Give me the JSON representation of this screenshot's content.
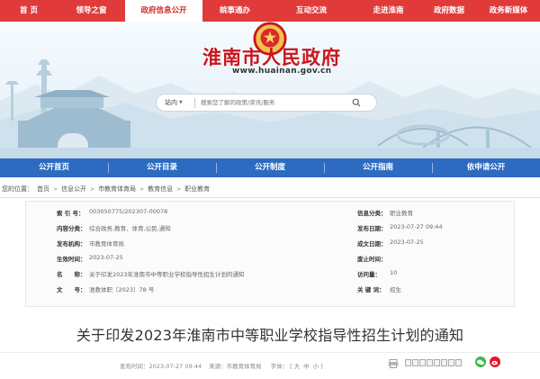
{
  "topnav": {
    "items": [
      "首 页",
      "领导之窗",
      "政府信息公开",
      "皖事通办",
      "互动交流",
      "走进淮南",
      "政府数据",
      "政务新媒体"
    ],
    "active_index": 2
  },
  "header": {
    "title": "淮南市人民政府",
    "url": "www.huainan.gov.cn"
  },
  "search": {
    "scope": "站内",
    "placeholder": "搜索您了解的政策/资讯/服务"
  },
  "subnav": {
    "items": [
      "公开首页",
      "公开目录",
      "公开制度",
      "公开指南",
      "依申请公开"
    ]
  },
  "breadcrumb": {
    "label": "您的位置：",
    "items": [
      "首页",
      "信息公开",
      "市教育体育局",
      "教育信息",
      "职业教育"
    ]
  },
  "info": {
    "left": [
      {
        "k": "索 引 号：",
        "v": "003050775/202307-00078"
      },
      {
        "k": "内容分类：",
        "v": "综合政务,教育、体育,公民,通知"
      },
      {
        "k": "发布机构：",
        "v": "市教育体育局"
      },
      {
        "k": "生效时间：",
        "v": "2023-07-25"
      },
      {
        "k": "名　　称：",
        "v": "关于印发2023年淮南市中等职业学校指导性招生计划的通知"
      },
      {
        "k": "文　　号：",
        "v": "淮教体职〔2023〕78 号"
      }
    ],
    "right": [
      {
        "k": "信息分类：",
        "v": "职业教育"
      },
      {
        "k": "发布日期：",
        "v": "2023-07-27 09:44"
      },
      {
        "k": "成文日期：",
        "v": "2023-07-25"
      },
      {
        "k": "废止时间：",
        "v": ""
      },
      {
        "k": "访问量：",
        "v": "10"
      },
      {
        "k": "关 键 词：",
        "v": "招生"
      }
    ]
  },
  "article": {
    "title": "关于印发2023年淮南市中等职业学校指导性招生计划的通知"
  },
  "meta": {
    "publish_label": "发布时间：",
    "publish_time": "2023-07-27 09:44",
    "source_label": "来源：",
    "source": "市教育体育局",
    "fontsize_label": "字体：",
    "sizes": [
      "大",
      "中",
      "小"
    ]
  },
  "colors": {
    "topnav_bg": "#e03b3a",
    "subnav_bg": "#2d6bc1",
    "title_red": "#c8161d"
  }
}
